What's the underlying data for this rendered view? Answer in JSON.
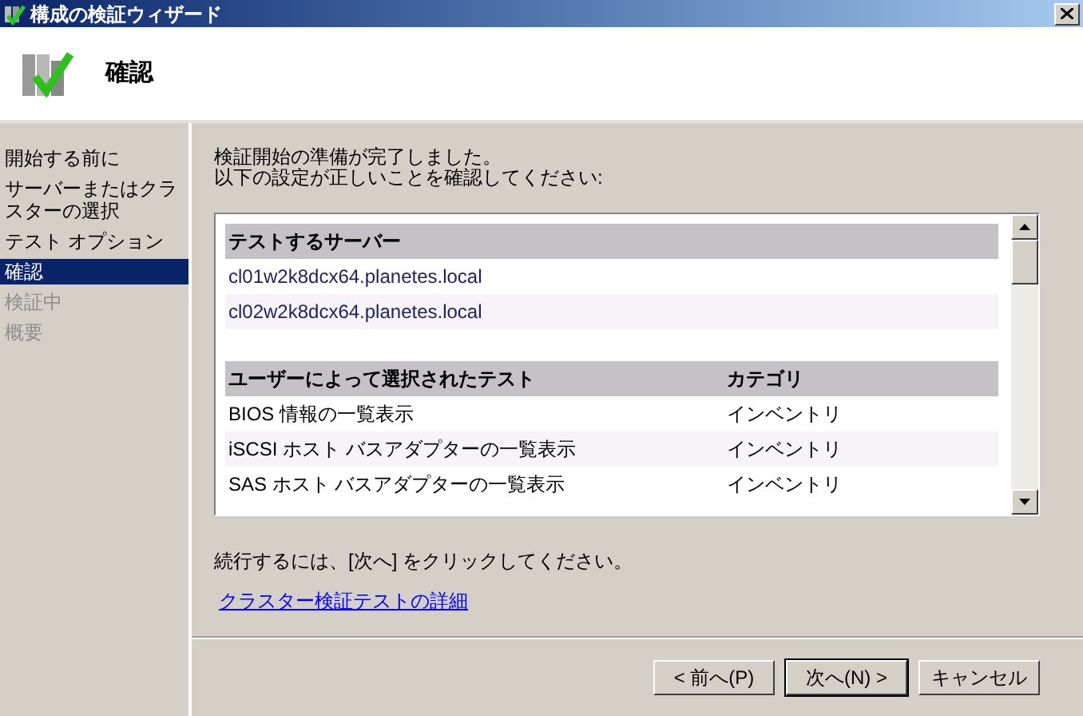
{
  "window": {
    "title": "構成の検証ウィザード"
  },
  "header": {
    "title": "確認"
  },
  "sidebar": {
    "items": [
      {
        "label": "開始する前に",
        "selected": false,
        "disabled": false
      },
      {
        "label": "サーバーまたはクラスターの選択",
        "selected": false,
        "disabled": false
      },
      {
        "label": "テスト オプション",
        "selected": false,
        "disabled": false
      },
      {
        "label": "確認",
        "selected": true,
        "disabled": false
      },
      {
        "label": "検証中",
        "selected": false,
        "disabled": true
      },
      {
        "label": "概要",
        "selected": false,
        "disabled": true
      }
    ]
  },
  "intro": [
    "検証開始の準備が完了しました。",
    "以下の設定が正しいことを確認してください:"
  ],
  "servers": {
    "heading": "テストするサーバー",
    "rows": [
      "cl01w2k8dcx64.planetes.local",
      "cl02w2k8dcx64.planetes.local"
    ]
  },
  "tests": {
    "columns": [
      "ユーザーによって選択されたテスト",
      "カテゴリ"
    ],
    "rows": [
      [
        "BIOS 情報の一覧表示",
        "インベントリ"
      ],
      [
        "iSCSI ホスト バスアダプターの一覧表示",
        "インベントリ"
      ],
      [
        "SAS ホスト バスアダプターの一覧表示",
        "インベントリ"
      ]
    ]
  },
  "continue_text": "続行するには、[次へ] をクリックしてください。",
  "link": "クラスター検証テストの詳細",
  "buttons": [
    {
      "label": "< 前へ(P)",
      "default": false
    },
    {
      "label": "次へ(N) >",
      "default": true
    },
    {
      "label": "キャンセル",
      "default": false
    }
  ]
}
